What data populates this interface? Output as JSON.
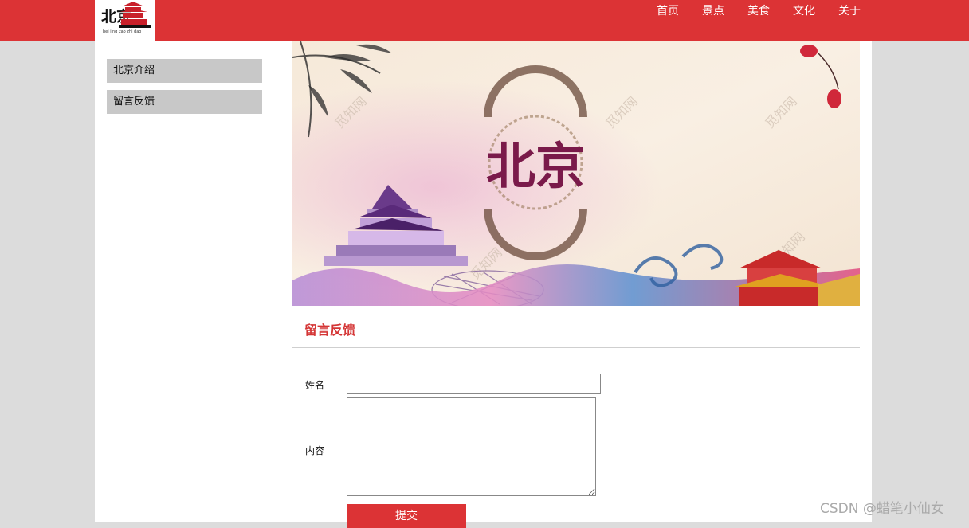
{
  "logo": {
    "text": "北京",
    "sub": "bei jing zao zhi dao"
  },
  "nav": [
    {
      "label": "首页"
    },
    {
      "label": "景点"
    },
    {
      "label": "美食"
    },
    {
      "label": "文化"
    },
    {
      "label": "关于"
    }
  ],
  "sidebar": {
    "items": [
      {
        "label": "北京介绍"
      },
      {
        "label": "留言反馈"
      }
    ]
  },
  "banner": {
    "title": "北京",
    "watermark": "觅知网"
  },
  "section": {
    "title": "留言反馈"
  },
  "form": {
    "name_label": "姓名",
    "name_value": "",
    "content_label": "内容",
    "content_value": "",
    "submit_label": "提交"
  },
  "watermark": "CSDN @蜡笔小仙女",
  "colors": {
    "primary": "#dc3335",
    "sidebar_item": "#c8c8c8",
    "page_bg": "#dcdcdc"
  }
}
